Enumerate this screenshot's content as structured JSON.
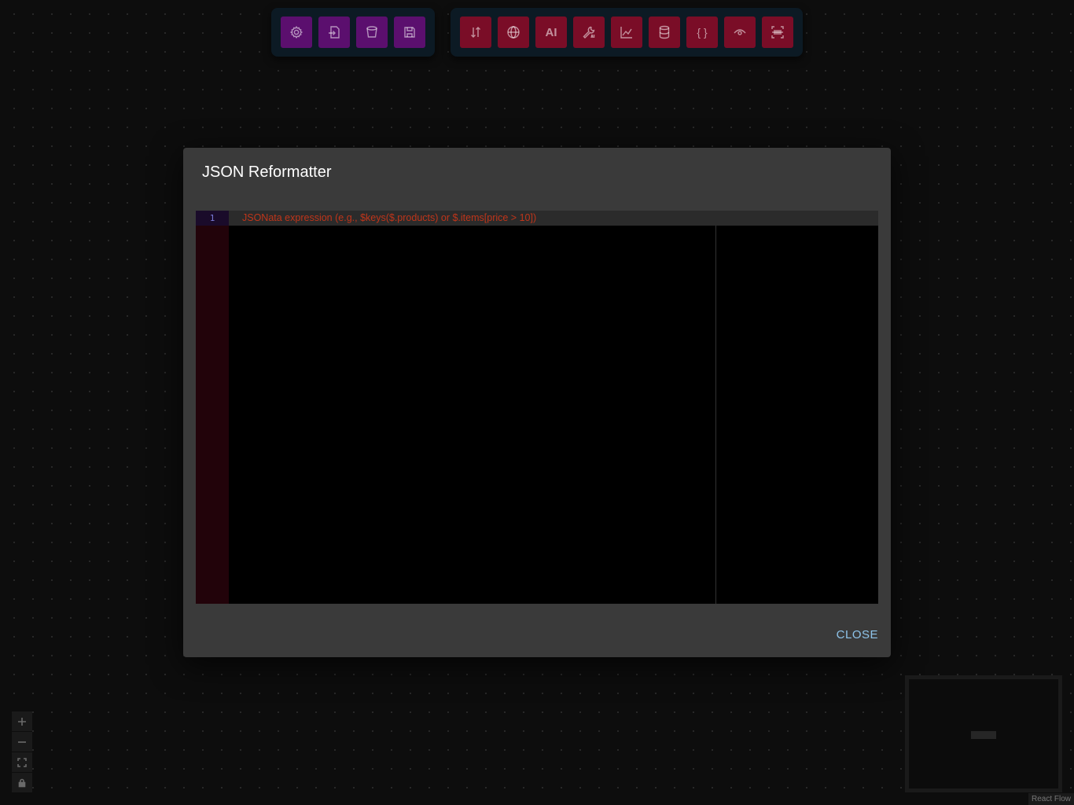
{
  "toolbar_left": [
    {
      "name": "settings-button",
      "icon": "gear-icon"
    },
    {
      "name": "import-button",
      "icon": "import-icon"
    },
    {
      "name": "clear-button",
      "icon": "bucket-icon"
    },
    {
      "name": "save-button",
      "icon": "save-icon"
    }
  ],
  "toolbar_right": [
    {
      "name": "sort-button",
      "icon": "sort-arrows-icon"
    },
    {
      "name": "web-button",
      "icon": "www-globe-icon"
    },
    {
      "name": "ai-button",
      "icon": "ai-text-icon",
      "text": "AI"
    },
    {
      "name": "ai-tool-button",
      "icon": "wrench-ai-icon"
    },
    {
      "name": "chart-button",
      "icon": "line-chart-icon"
    },
    {
      "name": "database-button",
      "icon": "database-icon"
    },
    {
      "name": "json-button",
      "icon": "braces-icon",
      "text": "{ }"
    },
    {
      "name": "preview-button",
      "icon": "eye-icon"
    },
    {
      "name": "scan-button",
      "icon": "barcode-scan-icon"
    }
  ],
  "modal": {
    "title": "JSON Reformatter",
    "editor": {
      "line_number": "1",
      "placeholder": "JSONata expression (e.g., $keys($.products) or $.items[price > 10])"
    },
    "close_label": "CLOSE"
  },
  "attribution": "React Flow",
  "colors": {
    "purple_button": "#5b0f6e",
    "red_button": "#7a0d27",
    "modal_bg": "#3a3a3a",
    "close_text": "#8ec4ea",
    "placeholder_text": "#c0351a"
  }
}
